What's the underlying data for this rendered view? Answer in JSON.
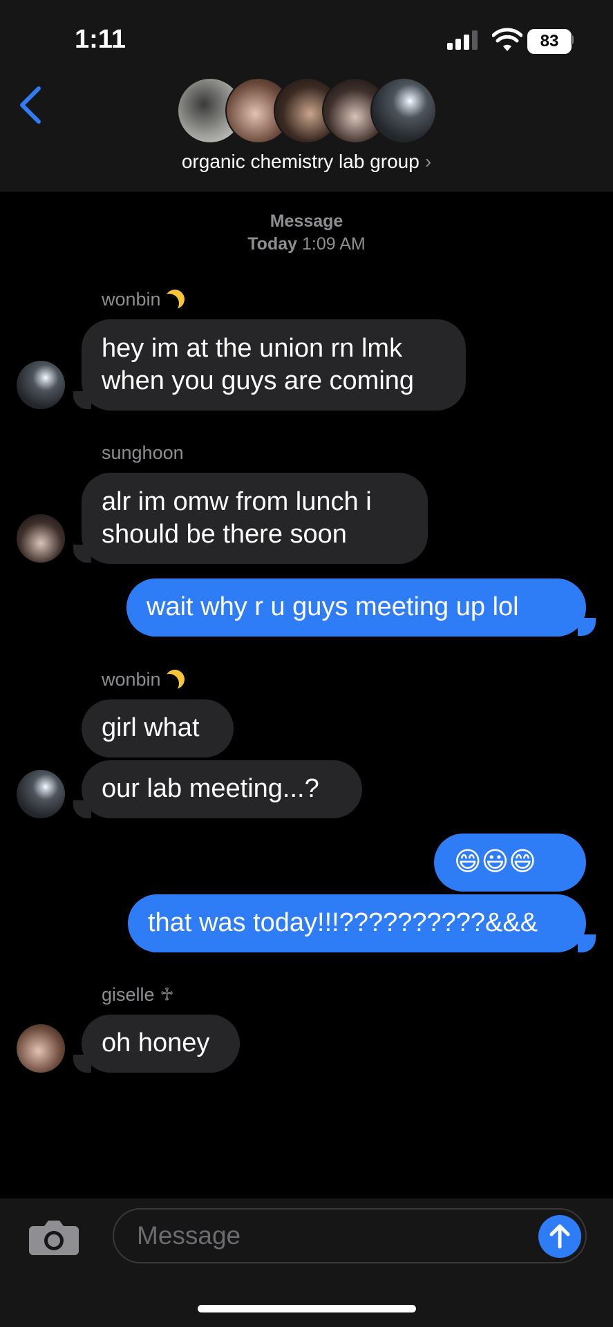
{
  "status": {
    "time": "1:11",
    "battery": "83"
  },
  "header": {
    "group_name": "organic chemistry lab group"
  },
  "thread_header": {
    "label": "Message",
    "day": "Today",
    "time": "1:09 AM"
  },
  "messages": {
    "m1_sender": "wonbin",
    "m1_text_l1": "hey im at the union rn lmk",
    "m1_text_l2": "when you guys are coming",
    "m2_sender": "sunghoon",
    "m2_text_l1": "alr im omw from lunch i",
    "m2_text_l2": "should be there soon",
    "m3_text": "wait why r u guys meeting up lol",
    "m4_sender": "wonbin",
    "m4_text": "girl what",
    "m5_text": "our lab meeting...?",
    "m6_text": "😄😃😄",
    "m7_text": "that was today!!!??????????&&&",
    "m8_sender": "giselle",
    "m8_symbol": "♱",
    "m8_text": "oh honey"
  },
  "composer": {
    "placeholder": "Message"
  },
  "colors": {
    "outgoing": "#2f7df6",
    "incoming": "#262628",
    "accent": "#2f7df6"
  },
  "icons": [
    "back-chevron-icon",
    "signal-icon",
    "wifi-icon",
    "battery-icon",
    "camera-icon",
    "send-arrow-icon",
    "moon-icon"
  ]
}
